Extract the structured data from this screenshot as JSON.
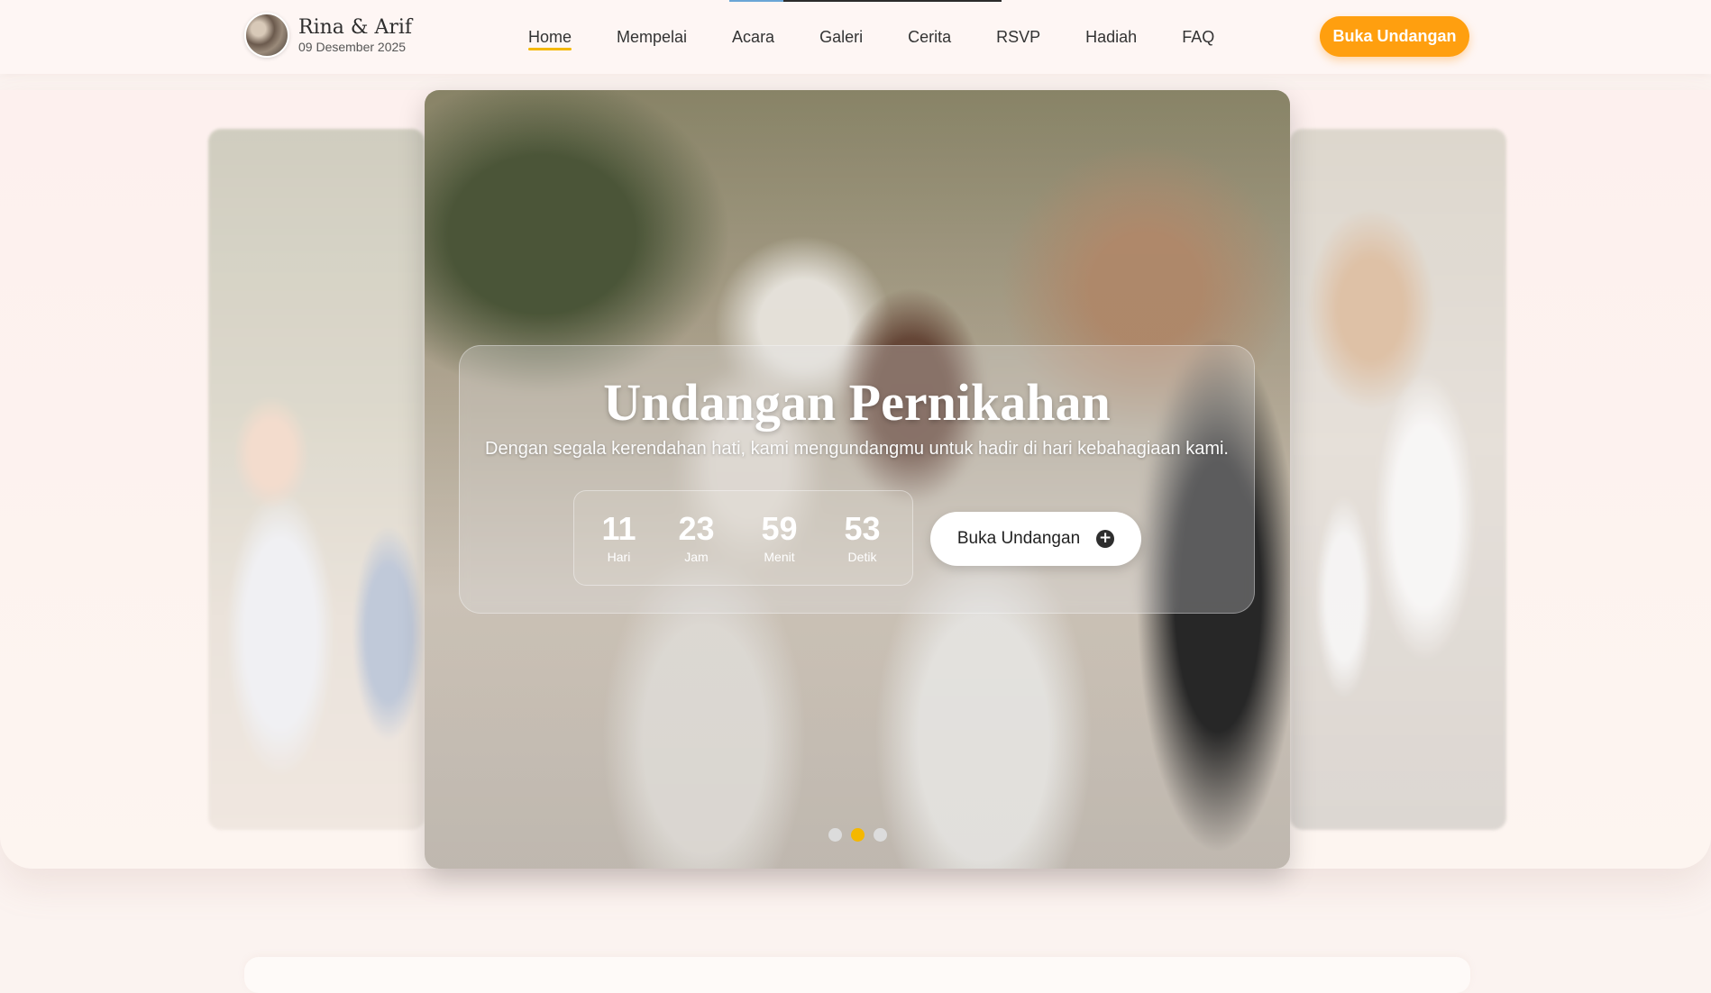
{
  "header": {
    "brand_title": "Rina & Arif",
    "brand_date": "09 Desember 2025",
    "nav": [
      "Home",
      "Mempelai",
      "Acara",
      "Galeri",
      "Cerita",
      "RSVP",
      "Hadiah",
      "FAQ"
    ],
    "active_nav": "Home",
    "cta_label": "Buka Undangan"
  },
  "hero": {
    "title": "Undangan Pernikahan",
    "subtitle": "Dengan segala kerendahan hati, kami mengundangmu untuk hadir di hari kebahagiaan kami.",
    "countdown": [
      {
        "value": "11",
        "label": "Hari"
      },
      {
        "value": "23",
        "label": "Jam"
      },
      {
        "value": "59",
        "label": "Menit"
      },
      {
        "value": "53",
        "label": "Detik"
      }
    ],
    "cta_label": "Buka Undangan",
    "cta_icon": "plus-circle-icon"
  },
  "carousel": {
    "slide_count": 3,
    "active_index": 1
  },
  "colors": {
    "accent": "#ff9f0f",
    "active_dot": "#f5b800",
    "nav_underline": "#f5b800"
  }
}
